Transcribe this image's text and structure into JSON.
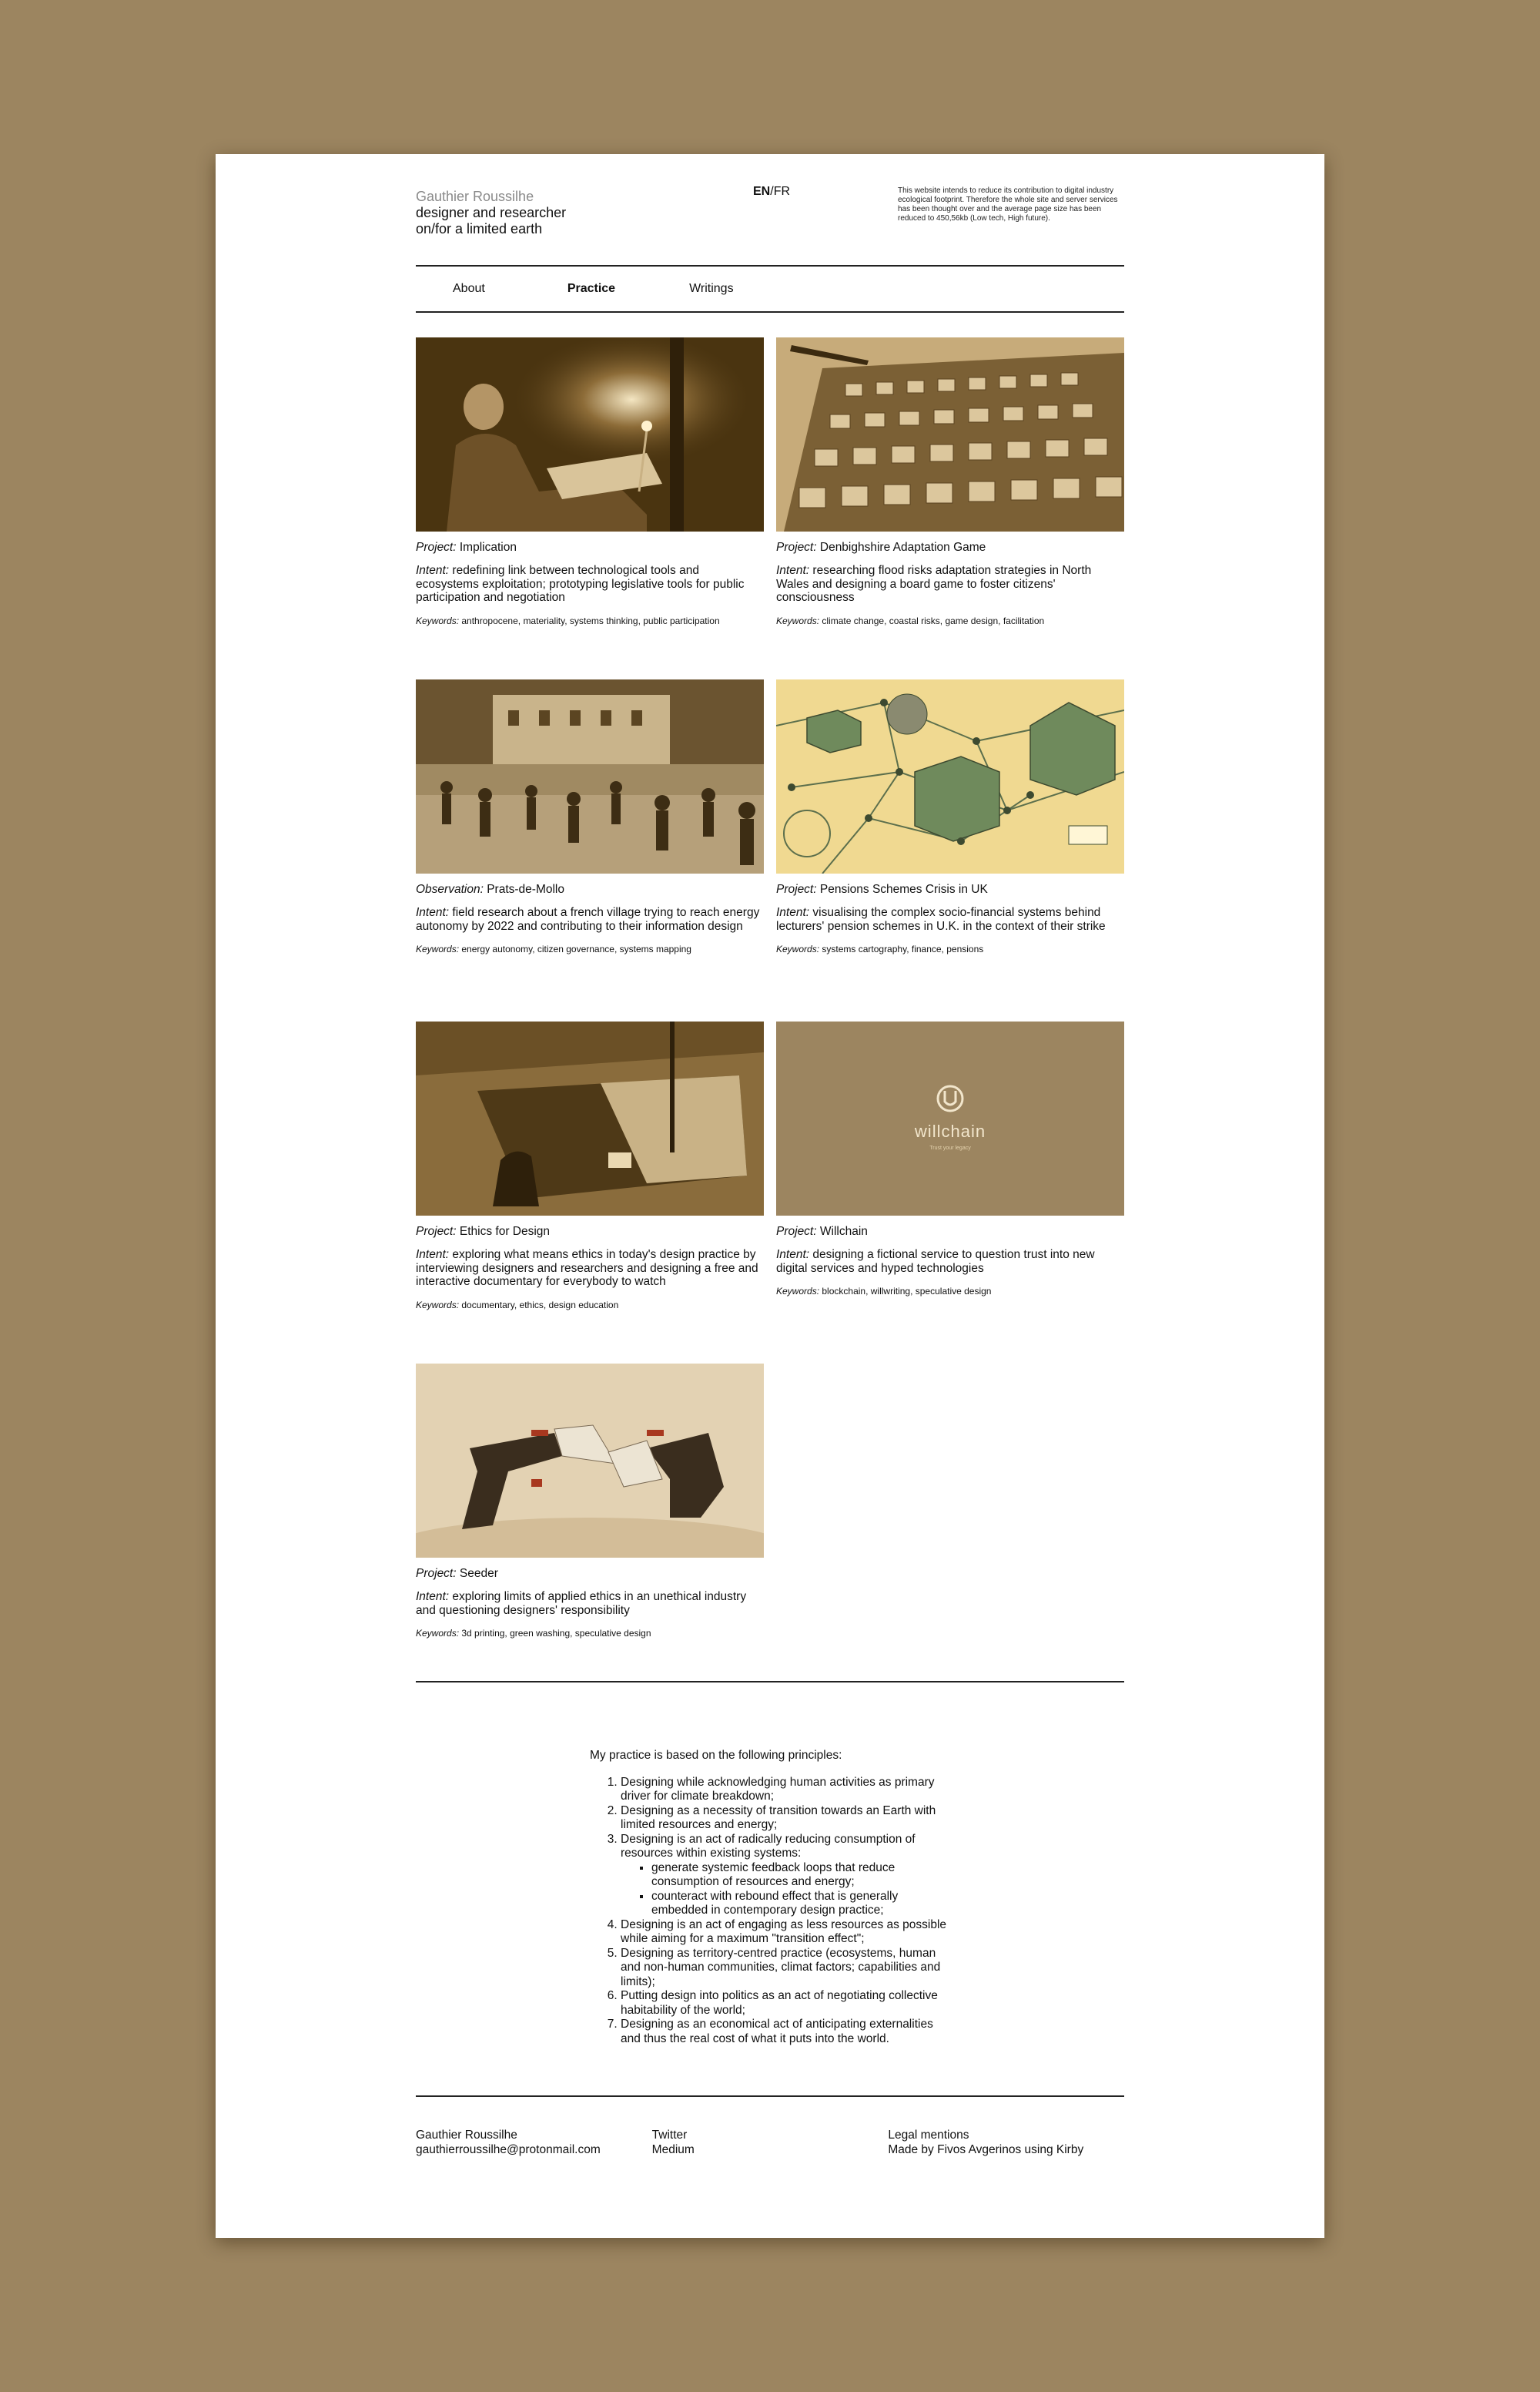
{
  "header": {
    "name": "Gauthier Roussilhe",
    "tagline_1": "designer and researcher",
    "tagline_2": "on/for a limited earth",
    "lang_active": "EN",
    "lang_sep": "/",
    "lang_other": "FR",
    "eco_note": "This website intends to reduce its contribution to digital industry ecological footprint. Therefore the whole site and server services has been thought over and the average page size has been reduced to 450,56kb (Low tech, High future)."
  },
  "nav": {
    "about": "About",
    "practice": "Practice",
    "writings": "Writings"
  },
  "labels": {
    "intent": "Intent:",
    "keywords": "Keywords:"
  },
  "projects": [
    {
      "kind": "Project:",
      "title": "Implication",
      "intent": "redefining link between technological tools and ecosystems exploitation; prototyping legislative tools for public participation and negotiation",
      "keywords": "anthropocene, materiality, systems thinking, public participation"
    },
    {
      "kind": "Project:",
      "title": "Denbighshire Adaptation Game",
      "intent": "researching flood risks adaptation strategies in North Wales and designing a board game to foster citizens' consciousness",
      "keywords": "climate change, coastal risks, game design, facilitation"
    },
    {
      "kind": "Observation:",
      "title": "Prats-de-Mollo",
      "intent": "field research about a french village trying to reach energy autonomy by 2022 and contributing to their information design",
      "keywords": "energy autonomy, citizen governance, systems mapping"
    },
    {
      "kind": "Project:",
      "title": "Pensions Schemes Crisis in UK",
      "intent": "visualising the complex socio-financial systems behind lecturers' pension schemes in U.K. in the context of their strike",
      "keywords": "systems cartography, finance, pensions"
    },
    {
      "kind": "Project:",
      "title": "Ethics for Design",
      "intent": "exploring what means ethics in today's design practice by interviewing designers and researchers and designing a free and interactive documentary for everybody to watch",
      "keywords": "documentary, ethics, design education"
    },
    {
      "kind": "Project:",
      "title": "Willchain",
      "intent": "designing a fictional service to question trust into new digital services and hyped technologies",
      "keywords": "blockchain, willwriting, speculative design",
      "logo_text": "willchain",
      "logo_sub": "Trust your legacy"
    },
    {
      "kind": "Project:",
      "title": "Seeder",
      "intent": "exploring limits of applied ethics in an unethical industry and questioning designers' responsibility",
      "keywords": "3d printing, green washing, speculative design"
    }
  ],
  "principles": {
    "intro": "My practice is based on the following principles:",
    "items": [
      "Designing while acknowledging human activities as primary driver for climate breakdown;",
      "Designing as a necessity of transition towards an Earth with limited resources and energy;",
      "Designing is an act of radically reducing consumption of resources within existing systems:",
      "Designing is an act of engaging as less resources as possible while aiming for a maximum \"transition effect\";",
      "Designing as territory-centred practice (ecosystems, human and non-human communities, climat factors; capabilities and limits);",
      "Putting design into politics as an act of negotiating collective habitability of the world;",
      "Designing as an economical act of anticipating externalities and thus the real cost of what it puts into the world."
    ],
    "subitems": [
      "generate systemic feedback loops that reduce consumption of resources and energy;",
      "counteract with rebound effect that is generally embedded in contemporary design practice;"
    ]
  },
  "footer": {
    "name": "Gauthier Roussilhe",
    "email": "gauthierroussilhe@protonmail.com",
    "twitter": "Twitter",
    "medium": "Medium",
    "legal": "Legal mentions",
    "credit": "Made by Fivos Avgerinos using Kirby"
  },
  "colors": {
    "page_bg": "#9c8560",
    "sheet_bg": "#ffffff",
    "sepia_dark": "#4a3410",
    "sepia_mid": "#8b6f3e",
    "sepia_light": "#d9c49a",
    "willchain_bg": "#9c8560"
  }
}
